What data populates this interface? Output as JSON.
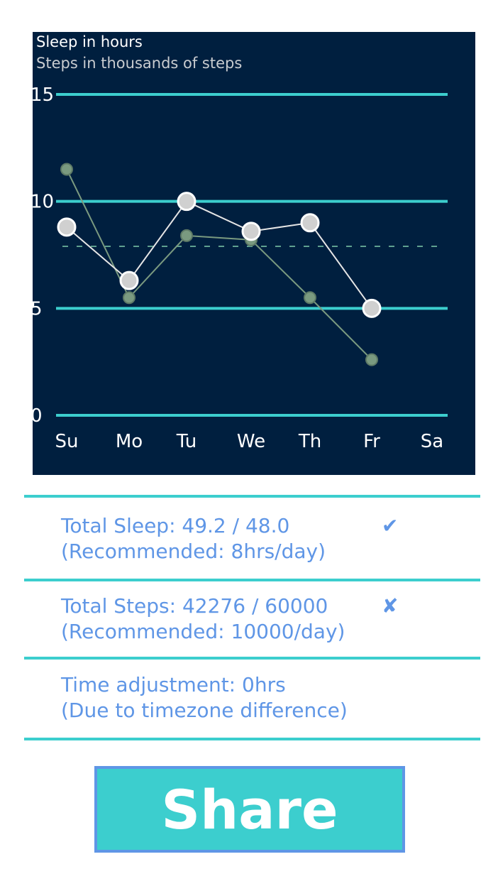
{
  "chart_data": {
    "type": "line",
    "categories": [
      "Su",
      "Mo",
      "Tu",
      "We",
      "Th",
      "Fr",
      "Sa"
    ],
    "series": [
      {
        "name": "Sleep in hours",
        "values": [
          8.8,
          6.3,
          10.0,
          8.6,
          9.0,
          5.0,
          null
        ],
        "color": "#ffffff"
      },
      {
        "name": "Steps in thousands of steps",
        "values": [
          11.5,
          5.5,
          8.4,
          8.2,
          5.5,
          2.6,
          null
        ],
        "color": "#c9ccd0"
      }
    ],
    "yticks": [
      0,
      5,
      10,
      15
    ],
    "ylim": [
      0,
      15
    ],
    "reference_line": 7.9,
    "colors": {
      "background": "#001f3f",
      "gridline": "#3ccece",
      "sleep_marker": "#d0d0d0",
      "steps_marker": "#7a9a80",
      "reference_line": "#5fa090"
    }
  },
  "legend": {
    "sleep": "Sleep in hours",
    "steps": "Steps in thousands of steps"
  },
  "summary": {
    "sleep": {
      "line1": "Total Sleep: 49.2 / 48.0",
      "line2": "(Recommended: 8hrs/day)",
      "status_icon": "check-icon",
      "status_glyph": "✔"
    },
    "steps": {
      "line1": "Total Steps: 42276 / 60000",
      "line2": "(Recommended: 10000/day)",
      "status_icon": "cross-icon",
      "status_glyph": "✘"
    },
    "time": {
      "line1": "Time adjustment: 0hrs",
      "line2": "(Due to timezone difference)"
    }
  },
  "share_button": {
    "label": "Share"
  },
  "colors": {
    "accent": "#3ccece",
    "text_blue": "#5f96e6",
    "panel": "#001f3f"
  }
}
